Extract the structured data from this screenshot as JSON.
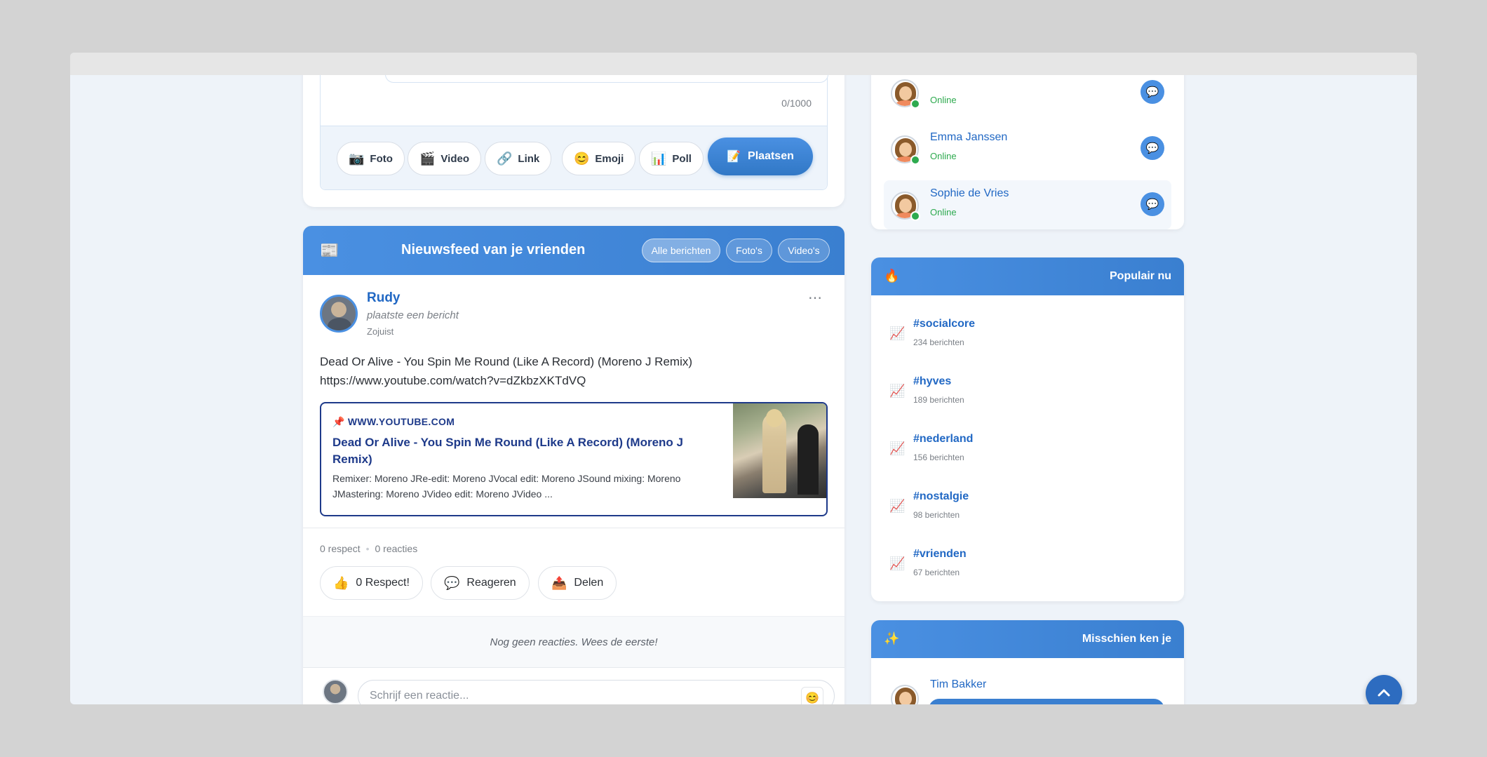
{
  "composer": {
    "char_count": "0/1000",
    "tools": [
      {
        "icon": "📷",
        "label": "Foto"
      },
      {
        "icon": "🎬",
        "label": "Video"
      },
      {
        "icon": "🔗",
        "label": "Link"
      },
      {
        "icon": "😊",
        "label": "Emoji"
      },
      {
        "icon": "📊",
        "label": "Poll"
      }
    ],
    "post_icon": "📝",
    "post_label": "Plaatsen"
  },
  "feed": {
    "icon": "📰",
    "title": "Nieuwsfeed van je vrienden",
    "filters": [
      "Alle berichten",
      "Foto's",
      "Video's"
    ]
  },
  "post": {
    "author": "Rudy",
    "action": "plaatste een bericht",
    "time": "Zojuist",
    "more": "⋯",
    "text_line1": "Dead Or Alive - You Spin Me Round (Like A Record) (Moreno J Remix)",
    "text_line2": "https://www.youtube.com/watch?v=dZkbzXKTdVQ",
    "link": {
      "domain": "📌 WWW.YOUTUBE.COM",
      "title": "Dead Or Alive - You Spin Me Round (Like A Record) (Moreno J Remix)",
      "description": "Remixer: Moreno JRe-edit: Moreno JVocal edit: Moreno JSound mixing: Moreno JMastering: Moreno JVideo edit: Moreno JVideo ..."
    },
    "stats": {
      "respect": "0 respect",
      "separator": "•",
      "reactions": "0 reacties"
    },
    "actions": [
      {
        "icon": "👍",
        "label": "0 Respect!"
      },
      {
        "icon": "💬",
        "label": "Reageren"
      },
      {
        "icon": "📤",
        "label": "Delen"
      }
    ],
    "no_comments": "Nog geen reacties. Wees de eerste!",
    "comment_placeholder": "Schrijf een reactie...",
    "emoji_icon": "😊"
  },
  "friends": [
    {
      "name": "",
      "status": "Online",
      "chat_icon": "💬"
    },
    {
      "name": "Emma Janssen",
      "status": "Online",
      "chat_icon": "💬"
    },
    {
      "name": "Sophie de Vries",
      "status": "Online",
      "chat_icon": "💬"
    }
  ],
  "popular": {
    "icon": "🔥",
    "title": "Populair nu",
    "tag_icon": "📈",
    "tags": [
      {
        "name": "#socialcore",
        "count": "234 berichten"
      },
      {
        "name": "#hyves",
        "count": "189 berichten"
      },
      {
        "name": "#nederland",
        "count": "156 berichten"
      },
      {
        "name": "#nostalgie",
        "count": "98 berichten"
      },
      {
        "name": "#vrienden",
        "count": "67 berichten"
      }
    ]
  },
  "maybe": {
    "icon": "✨",
    "title": "Misschien ken je",
    "person": "Tim Bakker"
  },
  "colors": {
    "accent": "#4a90e2",
    "online": "#2eaa4f",
    "link_border": "#1e3a8a"
  }
}
